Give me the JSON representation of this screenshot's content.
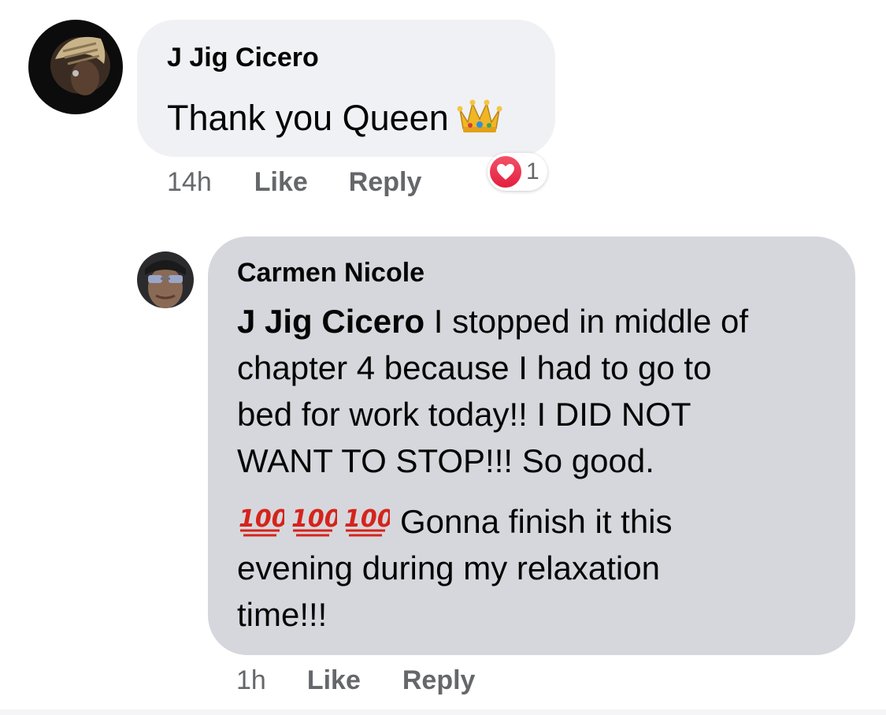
{
  "comments": [
    {
      "author": "J Jig Cicero",
      "text": "Thank you Queen",
      "emoji": "crown-emoji",
      "time": "14h",
      "like_label": "Like",
      "reply_label": "Reply",
      "reaction": {
        "type": "heart-icon",
        "count": "1",
        "color": "#e41e3f"
      }
    },
    {
      "author": "Carmen Nicole",
      "mention": "J Jig Cicero",
      "lines": [
        " I stopped in middle of",
        "chapter 4 because I had to go to",
        "bed for work today!! I DID NOT",
        "WANT TO STOP!!! So good.",
        "Gonna finish it this",
        "evening during my relaxation",
        "time!!!"
      ],
      "emoji": "hundred-points-emoji",
      "emoji_count": 3,
      "time": "1h",
      "like_label": "Like",
      "reply_label": "Reply"
    }
  ],
  "colors": {
    "bubble_primary": "#f0f1f5",
    "bubble_reply": "#d6d7dc",
    "meta_text": "#65676b"
  }
}
